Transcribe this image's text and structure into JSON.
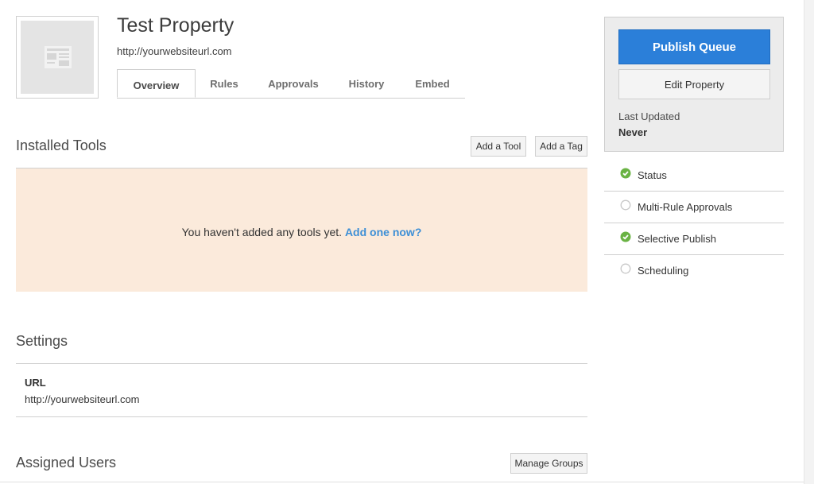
{
  "property": {
    "title": "Test Property",
    "url": "http://yourwebsiteurl.com"
  },
  "tabs": [
    {
      "label": "Overview",
      "active": true
    },
    {
      "label": "Rules"
    },
    {
      "label": "Approvals"
    },
    {
      "label": "History"
    },
    {
      "label": "Embed"
    }
  ],
  "installed_tools": {
    "title": "Installed Tools",
    "add_tool_label": "Add a Tool",
    "add_tag_label": "Add a Tag",
    "empty_message": "You haven't added any tools yet.",
    "empty_link": "Add one now?"
  },
  "settings": {
    "title": "Settings",
    "url_label": "URL",
    "url_value": "http://yourwebsiteurl.com"
  },
  "assigned_users": {
    "title": "Assigned Users",
    "manage_groups_label": "Manage Groups"
  },
  "sidebar": {
    "publish_queue_label": "Publish Queue",
    "edit_property_label": "Edit Property",
    "last_updated_label": "Last Updated",
    "last_updated_value": "Never",
    "features": [
      {
        "label": "Status",
        "enabled": true,
        "icon": "check-circle-icon"
      },
      {
        "label": "Multi-Rule Approvals",
        "enabled": false,
        "icon": "empty-circle-icon"
      },
      {
        "label": "Selective Publish",
        "enabled": true,
        "icon": "check-circle-icon"
      },
      {
        "label": "Scheduling",
        "enabled": false,
        "icon": "empty-circle-icon"
      }
    ]
  },
  "colors": {
    "primary": "#2b7fd9",
    "enabled": "#6ab344",
    "empty_bg": "#fbeadb",
    "link": "#3d8fd6"
  }
}
